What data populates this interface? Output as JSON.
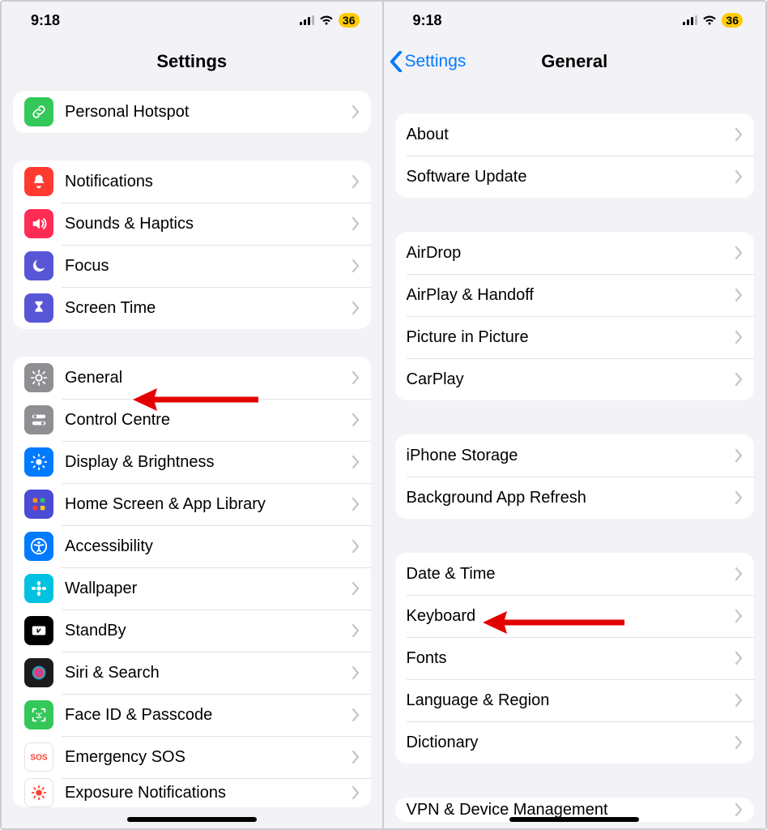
{
  "status": {
    "time": "9:18",
    "battery": "36"
  },
  "left": {
    "title": "Settings",
    "group1": [
      {
        "label": "Personal Hotspot",
        "icon": "link-icon",
        "bg": "#34c759"
      }
    ],
    "group2": [
      {
        "label": "Notifications",
        "icon": "bell-icon",
        "bg": "#ff3b30"
      },
      {
        "label": "Sounds & Haptics",
        "icon": "speaker-icon",
        "bg": "#ff2d55"
      },
      {
        "label": "Focus",
        "icon": "moon-icon",
        "bg": "#5856d6"
      },
      {
        "label": "Screen Time",
        "icon": "hourglass-icon",
        "bg": "#5856d6"
      }
    ],
    "group3": [
      {
        "label": "General",
        "icon": "gear-icon",
        "bg": "#8e8e93"
      },
      {
        "label": "Control Centre",
        "icon": "switches-icon",
        "bg": "#8e8e93"
      },
      {
        "label": "Display & Brightness",
        "icon": "sun-icon",
        "bg": "#007aff"
      },
      {
        "label": "Home Screen & App Library",
        "icon": "grid-icon",
        "bg": "#4b4bd6"
      },
      {
        "label": "Accessibility",
        "icon": "accessibility-icon",
        "bg": "#007aff"
      },
      {
        "label": "Wallpaper",
        "icon": "flower-icon",
        "bg": "#00c2e0"
      },
      {
        "label": "StandBy",
        "icon": "clock-icon",
        "bg": "#000000"
      },
      {
        "label": "Siri & Search",
        "icon": "siri-icon",
        "bg": "#1c1c1e"
      },
      {
        "label": "Face ID & Passcode",
        "icon": "faceid-icon",
        "bg": "#34c759"
      },
      {
        "label": "Emergency SOS",
        "icon": "sos-icon",
        "bg": "#ffffff",
        "fg": "#ff3b30"
      },
      {
        "label": "Exposure Notifications",
        "icon": "exposure-icon",
        "bg": "#ffffff",
        "fg": "#ff3b30"
      }
    ]
  },
  "right": {
    "back": "Settings",
    "title": "General",
    "group1": [
      {
        "label": "About"
      },
      {
        "label": "Software Update"
      }
    ],
    "group2": [
      {
        "label": "AirDrop"
      },
      {
        "label": "AirPlay & Handoff"
      },
      {
        "label": "Picture in Picture"
      },
      {
        "label": "CarPlay"
      }
    ],
    "group3": [
      {
        "label": "iPhone Storage"
      },
      {
        "label": "Background App Refresh"
      }
    ],
    "group4": [
      {
        "label": "Date & Time"
      },
      {
        "label": "Keyboard"
      },
      {
        "label": "Fonts"
      },
      {
        "label": "Language & Region"
      },
      {
        "label": "Dictionary"
      }
    ],
    "group5": [
      {
        "label": "VPN & Device Management"
      }
    ]
  }
}
